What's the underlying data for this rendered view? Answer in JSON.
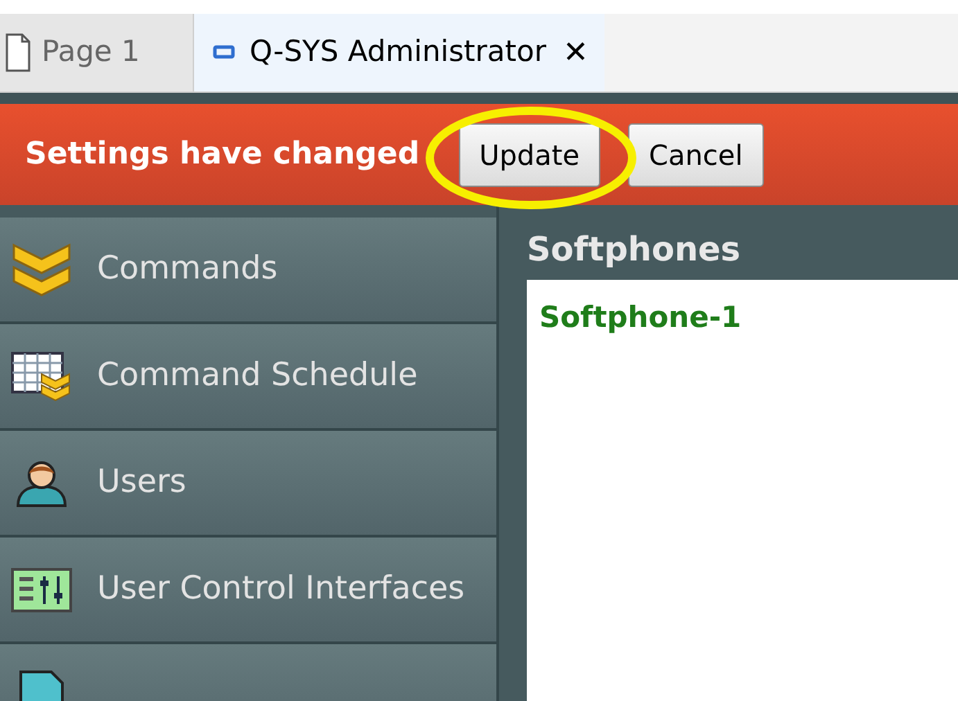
{
  "tabs": [
    {
      "label": "Page 1",
      "selected": false,
      "kind": "page"
    },
    {
      "label": "Q-SYS Administrator",
      "selected": true,
      "kind": "app",
      "close": "✕"
    }
  ],
  "notification": {
    "message": "Settings have changed",
    "buttons": [
      "Update",
      "Cancel"
    ]
  },
  "sidebar": {
    "items": [
      {
        "label": "Commands",
        "kind": "chevrons"
      },
      {
        "label": "Command Schedule",
        "kind": "schedule"
      },
      {
        "label": "Users",
        "kind": "user"
      },
      {
        "label": "User Control Interfaces",
        "kind": "uci"
      },
      {
        "kind": "file"
      }
    ]
  },
  "panel": {
    "title": "Softphones",
    "items": [
      "Softphone-1"
    ]
  }
}
